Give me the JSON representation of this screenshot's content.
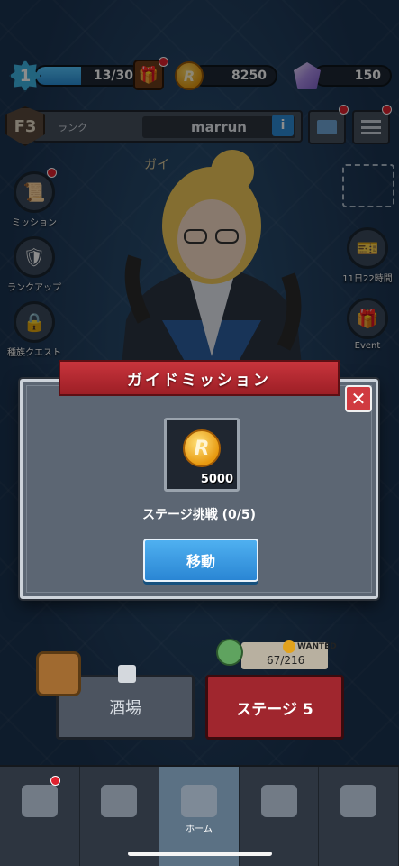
{
  "resources": {
    "level": "1",
    "stamina": "13/30",
    "stamina_fraction": 0.43,
    "coins": "8250",
    "gems": "150"
  },
  "player": {
    "floor": "F3",
    "rank_label": "ランク",
    "name": "marrun",
    "info": "i"
  },
  "guide_header": "ガイ",
  "side_menu": {
    "left": [
      {
        "label": "ミッション",
        "icon": "mission-scroll-icon"
      },
      {
        "label": "ランクアップ",
        "icon": "rank-up-icon"
      },
      {
        "label": "種族クエスト",
        "icon": "lock-icon"
      }
    ],
    "right": [
      {
        "label": "11日22時間",
        "icon": "ticket-icon"
      },
      {
        "label": "Event",
        "icon": "gift-icon"
      }
    ]
  },
  "modal": {
    "title": "ガイドミッション",
    "close": "✕",
    "reward_amount": "5000",
    "mission_text": "ステージ挑戦 (0/5)",
    "move_button": "移動"
  },
  "wanted": {
    "label": "WANTED",
    "count": "67/216"
  },
  "buttons": {
    "tavern": "酒場",
    "stage": "ステージ 5"
  },
  "nav": {
    "tabs": [
      {
        "label": "",
        "icon": "shop-icon"
      },
      {
        "label": "",
        "icon": "helmet-icon"
      },
      {
        "label": "ホーム",
        "icon": "crossed-swords-icon"
      },
      {
        "label": "",
        "icon": "shield-icon"
      },
      {
        "label": "",
        "icon": "castle-icon"
      }
    ]
  },
  "colors": {
    "accent_red": "#a0262e",
    "accent_blue": "#2a86d4",
    "background": "#1f3a57"
  }
}
